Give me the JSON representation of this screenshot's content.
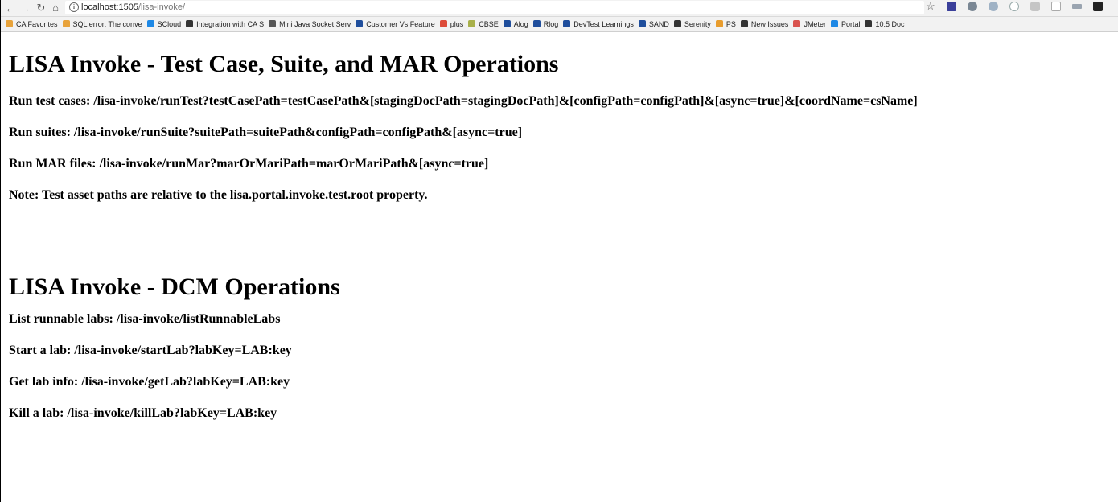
{
  "browser": {
    "url_host": "localhost:1505",
    "url_path": "/lisa-invoke/",
    "bookmarks": [
      {
        "label": "CA Favorites",
        "color": "#e8a33b"
      },
      {
        "label": "SQL error: The conve",
        "color": "#e8a33b"
      },
      {
        "label": "SCloud",
        "color": "#1e88e5"
      },
      {
        "label": "Integration with CA S",
        "color": "#333333"
      },
      {
        "label": "Mini Java Socket Serv",
        "color": "#555555"
      },
      {
        "label": "Customer Vs Feature",
        "color": "#1f4e9c"
      },
      {
        "label": "plus",
        "color": "#dd4b39"
      },
      {
        "label": "CBSE",
        "color": "#a8b04a"
      },
      {
        "label": "Alog",
        "color": "#1f4e9c"
      },
      {
        "label": "Rlog",
        "color": "#1f4e9c"
      },
      {
        "label": "DevTest Learnings",
        "color": "#1f4e9c"
      },
      {
        "label": "SAND",
        "color": "#1f4e9c"
      },
      {
        "label": "Serenity",
        "color": "#333333"
      },
      {
        "label": "PS",
        "color": "#e89c2d"
      },
      {
        "label": "New Issues",
        "color": "#333333"
      },
      {
        "label": "JMeter",
        "color": "#d9534f"
      },
      {
        "label": "Portal",
        "color": "#1e88e5"
      },
      {
        "label": "10.5 Doc",
        "color": "#333333"
      }
    ]
  },
  "page": {
    "section1_title": "LISA Invoke - Test Case, Suite, and MAR Operations",
    "section1_lines": [
      "Run test cases: /lisa-invoke/runTest?testCasePath=testCasePath&[stagingDocPath=stagingDocPath]&[configPath=configPath]&[async=true]&[coordName=csName]",
      "Run suites: /lisa-invoke/runSuite?suitePath=suitePath&configPath=configPath&[async=true]",
      "Run MAR files: /lisa-invoke/runMar?marOrMariPath=marOrMariPath&[async=true]",
      "Note: Test asset paths are relative to the lisa.portal.invoke.test.root property."
    ],
    "section2_title": "LISA Invoke - DCM Operations",
    "section2_lines": [
      "List runnable labs: /lisa-invoke/listRunnableLabs",
      "Start a lab: /lisa-invoke/startLab?labKey=LAB:key",
      "Get lab info: /lisa-invoke/getLab?labKey=LAB:key",
      "Kill a lab: /lisa-invoke/killLab?labKey=LAB:key"
    ]
  }
}
